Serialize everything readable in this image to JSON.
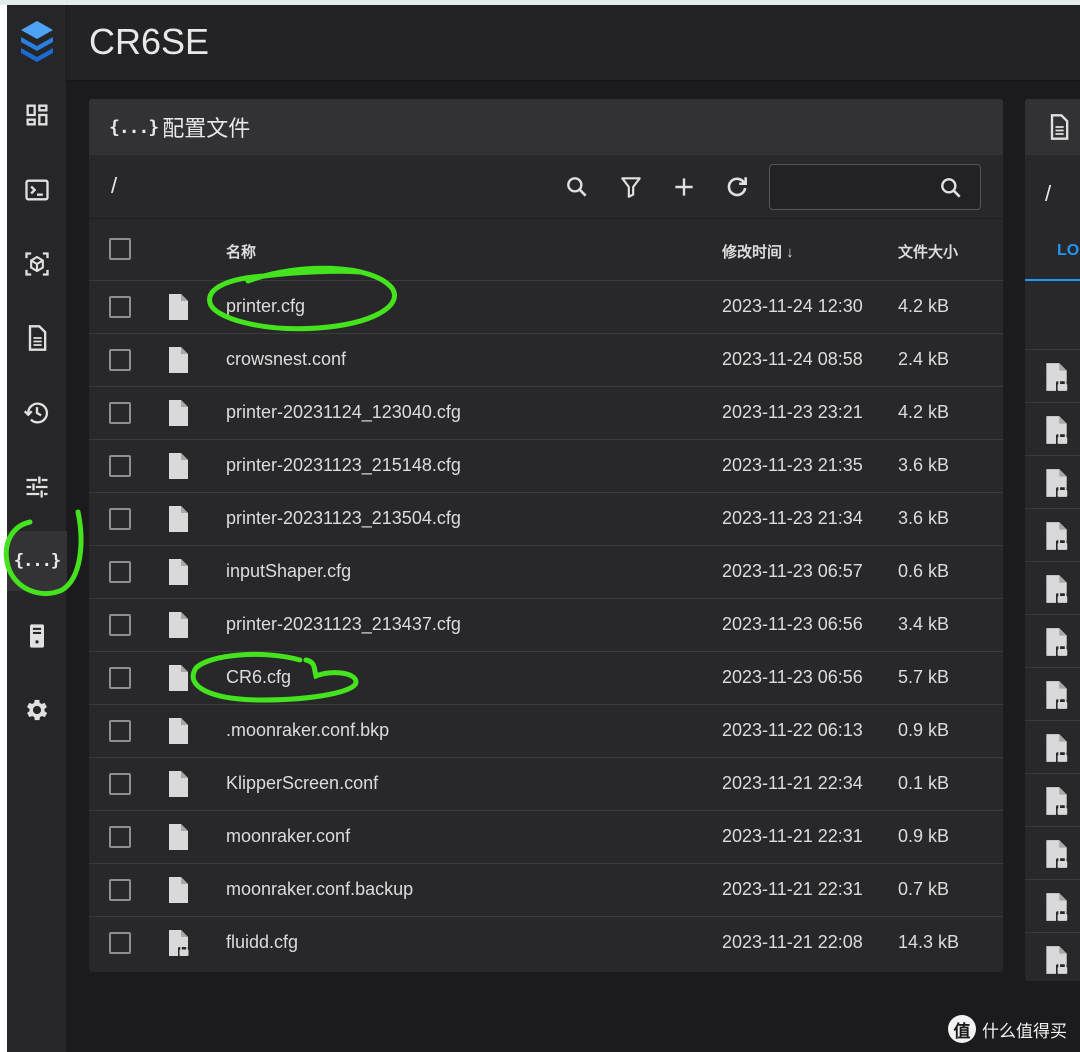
{
  "app": {
    "title": "CR6SE"
  },
  "colors": {
    "accent": "#2196f3",
    "highlight_marks": "#44e31d",
    "background": "#1b1b1d",
    "card": "#28282a"
  },
  "sidebar": {
    "items": [
      {
        "name": "dashboard-icon",
        "active": false
      },
      {
        "name": "console-icon",
        "active": false
      },
      {
        "name": "3d-view-icon",
        "active": false
      },
      {
        "name": "jobs-icon",
        "active": false
      },
      {
        "name": "history-icon",
        "active": false
      },
      {
        "name": "tune-icon",
        "active": false
      },
      {
        "name": "config-icon",
        "active": true,
        "glyph": "{...}"
      },
      {
        "name": "system-icon",
        "active": false
      },
      {
        "name": "settings-icon",
        "active": false
      }
    ]
  },
  "config_panel": {
    "title": "配置文件",
    "title_icon": "{...}",
    "path": "/",
    "search": {
      "value": "",
      "placeholder": ""
    },
    "columns": {
      "name": "名称",
      "modified": "修改时间 ↓",
      "size": "文件大小"
    },
    "files": [
      {
        "name": "printer.cfg",
        "modified": "2023-11-24 12:30",
        "size": "4.2 kB",
        "locked": false
      },
      {
        "name": "crowsnest.conf",
        "modified": "2023-11-24 08:58",
        "size": "2.4 kB",
        "locked": false
      },
      {
        "name": "printer-20231124_123040.cfg",
        "modified": "2023-11-23 23:21",
        "size": "4.2 kB",
        "locked": false
      },
      {
        "name": "printer-20231123_215148.cfg",
        "modified": "2023-11-23 21:35",
        "size": "3.6 kB",
        "locked": false
      },
      {
        "name": "printer-20231123_213504.cfg",
        "modified": "2023-11-23 21:34",
        "size": "3.6 kB",
        "locked": false
      },
      {
        "name": "inputShaper.cfg",
        "modified": "2023-11-23 06:57",
        "size": "0.6 kB",
        "locked": false
      },
      {
        "name": "printer-20231123_213437.cfg",
        "modified": "2023-11-23 06:56",
        "size": "3.4 kB",
        "locked": false
      },
      {
        "name": "CR6.cfg",
        "modified": "2023-11-23 06:56",
        "size": "5.7 kB",
        "locked": false
      },
      {
        "name": ".moonraker.conf.bkp",
        "modified": "2023-11-22 06:13",
        "size": "0.9 kB",
        "locked": false
      },
      {
        "name": "KlipperScreen.conf",
        "modified": "2023-11-21 22:34",
        "size": "0.1 kB",
        "locked": false
      },
      {
        "name": "moonraker.conf",
        "modified": "2023-11-21 22:31",
        "size": "0.9 kB",
        "locked": false
      },
      {
        "name": "moonraker.conf.backup",
        "modified": "2023-11-21 22:31",
        "size": "0.7 kB",
        "locked": false
      },
      {
        "name": "fluidd.cfg",
        "modified": "2023-11-21 22:08",
        "size": "14.3 kB",
        "locked": true
      }
    ]
  },
  "logs_panel": {
    "path": "/",
    "tab_label": "LO",
    "rows": 12
  },
  "watermark": {
    "logo": "值",
    "text": "什么值得买"
  }
}
